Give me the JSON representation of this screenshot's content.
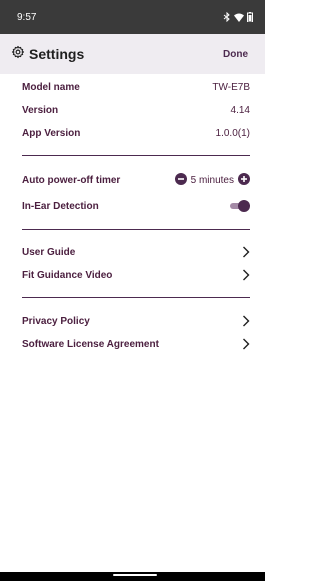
{
  "status_bar": {
    "time": "9:57",
    "icons": [
      "bluetooth-icon",
      "wifi-icon",
      "battery-icon"
    ]
  },
  "header": {
    "settings_icon": "gear-icon",
    "title": "Settings",
    "done_label": "Done"
  },
  "info": [
    {
      "label": "Model name",
      "value": "TW-E7B"
    },
    {
      "label": "Version",
      "value": "4.14"
    },
    {
      "label": "App Version",
      "value": "1.0.0(1)"
    }
  ],
  "auto_power_off": {
    "label": "Auto power-off timer",
    "value": "5 minutes",
    "decrease_icon": "minus-circle-icon",
    "increase_icon": "plus-circle-icon"
  },
  "in_ear_detection": {
    "label": "In-Ear Detection",
    "enabled": true
  },
  "guides": [
    {
      "label": "User Guide",
      "icon": "chevron-right-icon"
    },
    {
      "label": "Fit Guidance Video",
      "icon": "chevron-right-icon"
    }
  ],
  "legal": [
    {
      "label": "Privacy Policy",
      "icon": "chevron-right-icon"
    },
    {
      "label": "Software License Agreement",
      "icon": "chevron-right-icon"
    }
  ],
  "colors": {
    "accent": "#4c2a4f",
    "header_bg": "#efecf1",
    "status_bar_bg": "#3a3a3a"
  }
}
